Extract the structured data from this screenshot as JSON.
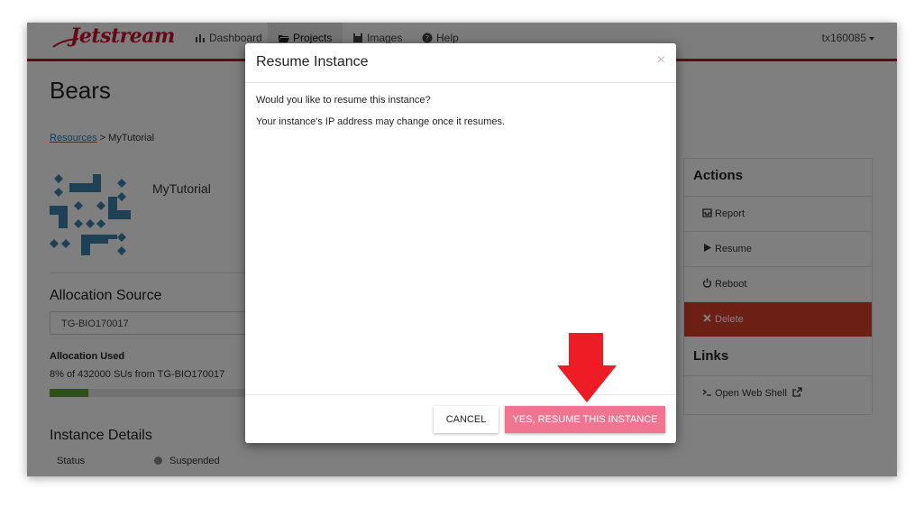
{
  "navbar": {
    "logo": "Jetstream",
    "items": [
      {
        "label": "Dashboard",
        "icon": "bar-chart-icon"
      },
      {
        "label": "Projects",
        "icon": "folder-open-icon"
      },
      {
        "label": "Images",
        "icon": "floppy-icon"
      },
      {
        "label": "Help",
        "icon": "question-circle-icon"
      }
    ],
    "active_item": "Projects",
    "user": "tx160085"
  },
  "page": {
    "title": "Bears",
    "breadcrumb": {
      "link": "Resources",
      "separator": " > ",
      "current": "MyTutorial"
    },
    "instance_name": "MyTutorial"
  },
  "allocation": {
    "title": "Allocation Source",
    "selected": "TG-BIO170017",
    "used_label": "Allocation Used",
    "used_text": "8% of 432000 SUs from TG-BIO170017",
    "used_fraction": 0.08
  },
  "details": {
    "title": "Instance Details",
    "status_label": "Status",
    "status_value": "Suspended"
  },
  "actions_panel": {
    "actions_title": "Actions",
    "actions": [
      {
        "label": "Report",
        "icon": "inbox-icon"
      },
      {
        "label": "Resume",
        "icon": "play-icon"
      },
      {
        "label": "Reboot",
        "icon": "power-icon"
      },
      {
        "label": "Delete",
        "icon": "close-icon"
      }
    ],
    "links_title": "Links",
    "links": [
      {
        "label": "Open Web Shell",
        "icon": "terminal-icon"
      }
    ]
  },
  "modal": {
    "title": "Resume Instance",
    "close": "×",
    "body_line1": "Would you like to resume this instance?",
    "body_line2": "Your instance's IP address may change once it resumes.",
    "cancel_label": "CANCEL",
    "confirm_label": "YES, RESUME THIS INSTANCE"
  },
  "colors": {
    "brand_red": "#c8102e",
    "confirm_pink": "#f07591",
    "delete_red": "#d9402b",
    "progress_green": "#5aa02c",
    "annotation_arrow": "#ee1c24"
  }
}
